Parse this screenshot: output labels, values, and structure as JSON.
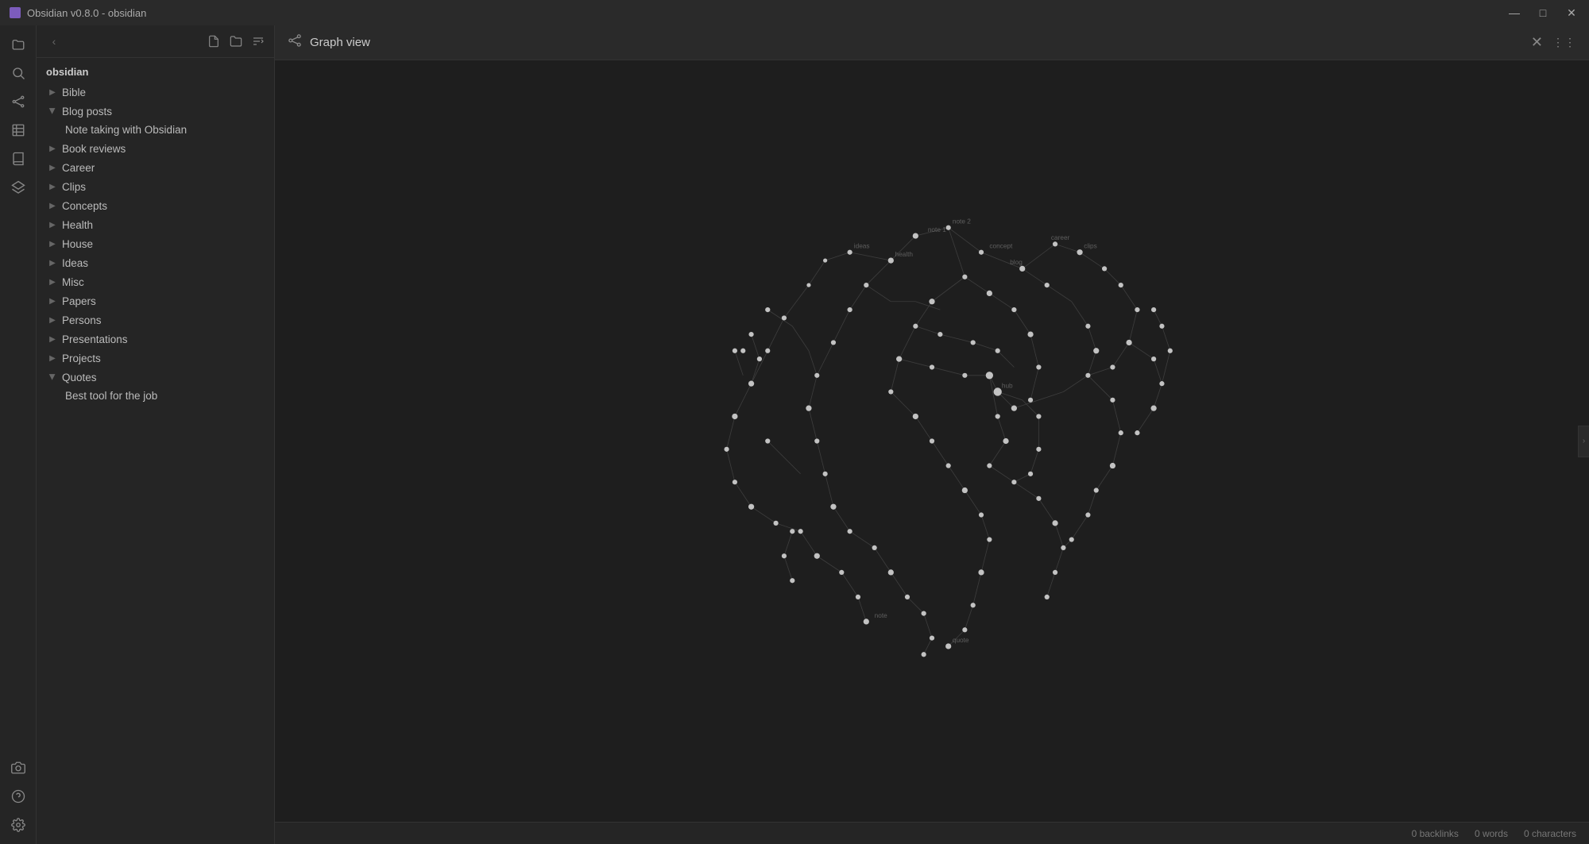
{
  "window": {
    "title": "Obsidian v0.8.0 - obsidian",
    "icon": "obsidian-icon"
  },
  "titlebar": {
    "minimize_label": "—",
    "maximize_label": "□",
    "close_label": "✕"
  },
  "sidebar": {
    "root_label": "obsidian",
    "new_file_tooltip": "New file",
    "new_folder_tooltip": "New folder",
    "sort_tooltip": "Sort",
    "items": [
      {
        "id": "bible",
        "label": "Bible",
        "expanded": false,
        "children": []
      },
      {
        "id": "blog-posts",
        "label": "Blog posts",
        "expanded": true,
        "children": [
          {
            "id": "note-taking",
            "label": "Note taking with Obsidian"
          }
        ]
      },
      {
        "id": "book-reviews",
        "label": "Book reviews",
        "expanded": false,
        "children": []
      },
      {
        "id": "career",
        "label": "Career",
        "expanded": false,
        "children": []
      },
      {
        "id": "clips",
        "label": "Clips",
        "expanded": false,
        "children": []
      },
      {
        "id": "concepts",
        "label": "Concepts",
        "expanded": false,
        "children": []
      },
      {
        "id": "health",
        "label": "Health",
        "expanded": false,
        "children": []
      },
      {
        "id": "house",
        "label": "House",
        "expanded": false,
        "children": []
      },
      {
        "id": "ideas",
        "label": "Ideas",
        "expanded": false,
        "children": []
      },
      {
        "id": "misc",
        "label": "Misc",
        "expanded": false,
        "children": []
      },
      {
        "id": "papers",
        "label": "Papers",
        "expanded": false,
        "children": []
      },
      {
        "id": "persons",
        "label": "Persons",
        "expanded": false,
        "children": []
      },
      {
        "id": "presentations",
        "label": "Presentations",
        "expanded": false,
        "children": []
      },
      {
        "id": "projects",
        "label": "Projects",
        "expanded": false,
        "children": []
      },
      {
        "id": "quotes",
        "label": "Quotes",
        "expanded": true,
        "children": [
          {
            "id": "best-tool",
            "label": "Best tool for the job"
          }
        ]
      }
    ]
  },
  "panel": {
    "title": "Graph view",
    "close_label": "✕",
    "more_label": "⋮⋮"
  },
  "status_bar": {
    "backlinks": "0 backlinks",
    "words": "0 words",
    "characters": "0 characters"
  },
  "rail": {
    "icons": [
      {
        "id": "folder",
        "symbol": "📁",
        "active": false
      },
      {
        "id": "search",
        "symbol": "🔍",
        "active": false
      },
      {
        "id": "graph",
        "symbol": "⬡",
        "active": false
      },
      {
        "id": "table",
        "symbol": "▦",
        "active": false
      },
      {
        "id": "book",
        "symbol": "📖",
        "active": false
      },
      {
        "id": "layers",
        "symbol": "◫",
        "active": false
      },
      {
        "id": "camera",
        "symbol": "📷",
        "active": false
      },
      {
        "id": "help",
        "symbol": "?",
        "active": false
      },
      {
        "id": "settings",
        "symbol": "⚙",
        "active": false
      }
    ]
  }
}
